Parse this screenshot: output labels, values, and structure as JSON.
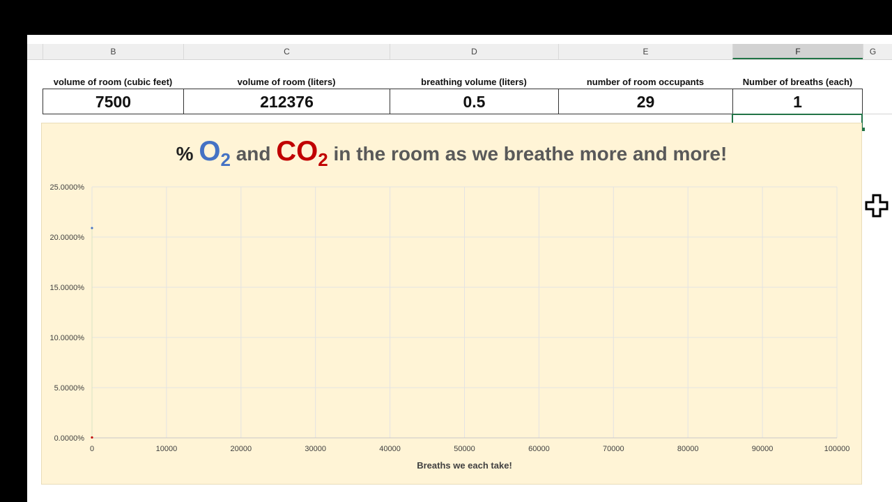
{
  "columns": [
    "B",
    "C",
    "D",
    "E",
    "F",
    "G"
  ],
  "selected_column": "F",
  "table": {
    "headers": [
      "volume of room (cubic feet)",
      "volume of room (liters)",
      "breathing volume (liters)",
      "number of room occupants",
      "Number of breaths (each)"
    ],
    "values": [
      "7500",
      "212376",
      "0.5",
      "29",
      "1"
    ]
  },
  "chart": {
    "title_prefix": "%",
    "o2_main": "O",
    "o2_sub": "2",
    "and_word": "and",
    "co2_main": "CO",
    "co2_sub": "2",
    "title_suffix": "in the room as we breathe more and more!"
  },
  "chart_data": {
    "type": "scatter",
    "title": "% O2 and CO2 in the room as we breathe more and more!",
    "xlabel": "Breaths we each take!",
    "ylabel": "",
    "xlim": [
      0,
      100000
    ],
    "ylim": [
      0,
      0.25
    ],
    "x_ticks": [
      "0",
      "10000",
      "20000",
      "30000",
      "40000",
      "50000",
      "60000",
      "70000",
      "80000",
      "90000",
      "100000"
    ],
    "y_ticks": [
      "0.0000%",
      "5.0000%",
      "10.0000%",
      "15.0000%",
      "20.0000%",
      "25.0000%"
    ],
    "grid": true,
    "series": [
      {
        "points": [
          [
            0,
            0.209
          ]
        ],
        "color": "#4472c4"
      },
      {
        "points": [
          [
            0,
            0.0004
          ]
        ],
        "color": "#c00000"
      }
    ],
    "colors": {
      "o2": "#4472c4",
      "co2": "#c00000",
      "background": "#fff4d6"
    }
  }
}
